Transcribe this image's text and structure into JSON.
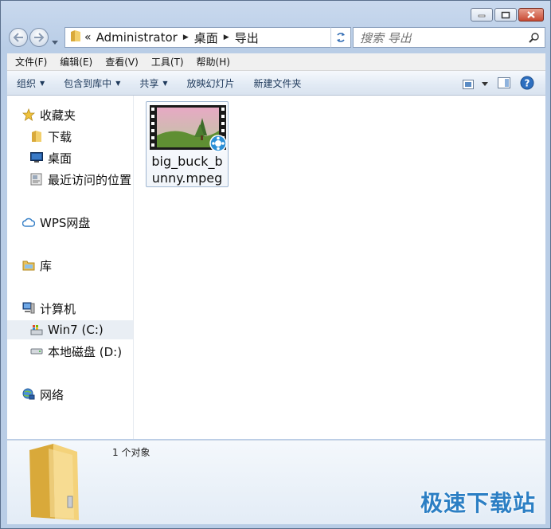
{
  "window": {
    "minimize_icon": "minimize-icon",
    "maximize_icon": "maximize-icon",
    "close_icon": "close-icon"
  },
  "address_bar": {
    "overflow": "«",
    "segments": [
      "Administrator",
      "桌面",
      "导出"
    ]
  },
  "search": {
    "placeholder": "搜索 导出"
  },
  "menu": [
    "文件(F)",
    "编辑(E)",
    "查看(V)",
    "工具(T)",
    "帮助(H)"
  ],
  "toolbar": {
    "organize": "组织",
    "include_in_library": "包含到库中",
    "share": "共享",
    "slideshow": "放映幻灯片",
    "new_folder": "新建文件夹"
  },
  "nav": {
    "favorites": "收藏夹",
    "downloads": "下载",
    "desktop": "桌面",
    "recent": "最近访问的位置",
    "wps": "WPS网盘",
    "libraries": "库",
    "computer": "计算机",
    "drive_c": "Win7 (C:)",
    "drive_d": "本地磁盘 (D:)",
    "network": "网络"
  },
  "files": [
    {
      "name_line1": "big_buck_b",
      "name_line2": "unny.mpeg",
      "icon": "video-file-icon"
    }
  ],
  "status": {
    "count": "1 个对象"
  },
  "watermark": "极速下载站",
  "colors": {
    "accent": "#2c7fc4",
    "selection": "#e9eef4"
  }
}
